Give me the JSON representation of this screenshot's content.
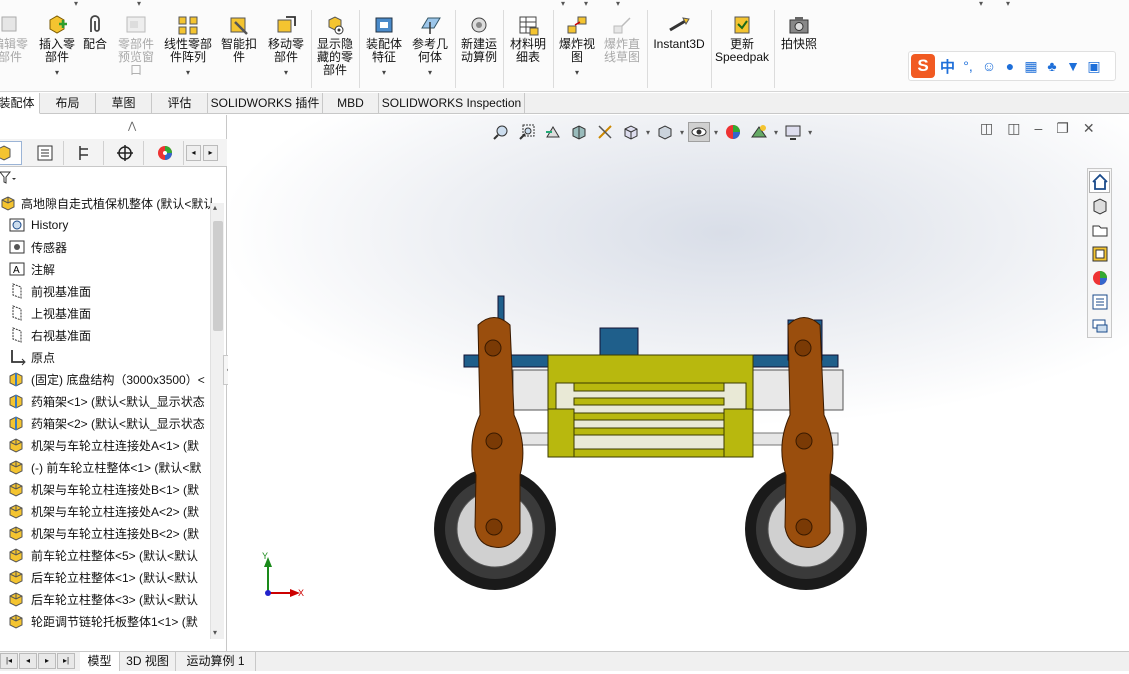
{
  "ribbon": {
    "buttons": [
      {
        "name": "edit-component-button",
        "label": "编辑零\n部件",
        "disabled": true,
        "dropdown": false
      },
      {
        "name": "insert-component-button",
        "label": "插入零\n部件",
        "disabled": false,
        "dropdown": true
      },
      {
        "name": "mate-button",
        "label": "配合",
        "disabled": false,
        "dropdown": false
      },
      {
        "name": "component-preview-window-button",
        "label": "零部件\n预览窗\n口",
        "disabled": true,
        "dropdown": false
      },
      {
        "name": "linear-component-pattern-button",
        "label": "线性零部\n件阵列",
        "disabled": false,
        "dropdown": true
      },
      {
        "name": "smart-fasteners-button",
        "label": "智能扣\n件",
        "disabled": false,
        "dropdown": false
      },
      {
        "name": "move-component-button",
        "label": "移动零\n部件",
        "disabled": false,
        "dropdown": true
      },
      {
        "name": "show-hidden-components-button",
        "label": "显示隐\n藏的零\n部件",
        "disabled": false,
        "dropdown": false
      },
      {
        "name": "assembly-features-button",
        "label": "装配体\n特征",
        "disabled": false,
        "dropdown": true
      },
      {
        "name": "reference-geometry-button",
        "label": "参考几\n何体",
        "disabled": false,
        "dropdown": true
      },
      {
        "name": "new-motion-study-button",
        "label": "新建运\n动算例",
        "disabled": false,
        "dropdown": false
      },
      {
        "name": "bill-of-materials-button",
        "label": "材料明\n细表",
        "disabled": false,
        "dropdown": false
      },
      {
        "name": "exploded-view-button",
        "label": "爆炸视\n图",
        "disabled": false,
        "dropdown": true
      },
      {
        "name": "explode-line-sketch-button",
        "label": "爆炸直\n线草图",
        "disabled": true,
        "dropdown": false
      },
      {
        "name": "instant3d-button",
        "label": "Instant3D",
        "disabled": false,
        "dropdown": false
      },
      {
        "name": "update-speedpak-button",
        "label": "更新\nSpeedpak",
        "disabled": false,
        "dropdown": false
      },
      {
        "name": "take-snapshot-button",
        "label": "拍快照",
        "disabled": false,
        "dropdown": false
      }
    ]
  },
  "ime": {
    "logo": "S",
    "lang": "中"
  },
  "tabs": [
    "装配体",
    "布局",
    "草图",
    "评估",
    "SOLIDWORKS 插件",
    "MBD",
    "SOLIDWORKS Inspection"
  ],
  "tree": {
    "root": "高地隙自走式植保机整体  (默认<默认_",
    "items": [
      {
        "label": "History",
        "icon": "history"
      },
      {
        "label": "传感器",
        "icon": "sensor"
      },
      {
        "label": "注解",
        "icon": "annotation"
      },
      {
        "label": "前视基准面",
        "icon": "plane"
      },
      {
        "label": "上视基准面",
        "icon": "plane"
      },
      {
        "label": "右视基准面",
        "icon": "plane"
      },
      {
        "label": "原点",
        "icon": "origin"
      },
      {
        "label": "(固定) 底盘结构（3000x3500）<",
        "icon": "part"
      },
      {
        "label": "药箱架<1> (默认<默认_显示状态",
        "icon": "part"
      },
      {
        "label": "药箱架<2> (默认<默认_显示状态",
        "icon": "part"
      },
      {
        "label": "机架与车轮立柱连接处A<1> (默",
        "icon": "asm"
      },
      {
        "label": "(-) 前车轮立柱整体<1> (默认<默",
        "icon": "asm"
      },
      {
        "label": "机架与车轮立柱连接处B<1> (默",
        "icon": "asm"
      },
      {
        "label": "机架与车轮立柱连接处A<2> (默",
        "icon": "asm"
      },
      {
        "label": "机架与车轮立柱连接处B<2> (默",
        "icon": "asm"
      },
      {
        "label": "前车轮立柱整体<5> (默认<默认",
        "icon": "asm"
      },
      {
        "label": "后车轮立柱整体<1> (默认<默认",
        "icon": "asm"
      },
      {
        "label": "后车轮立柱整体<3> (默认<默认",
        "icon": "asm"
      },
      {
        "label": "轮距调节链轮托板整体1<1> (默",
        "icon": "asm"
      }
    ]
  },
  "bottom_tabs": [
    "模型",
    "3D 视图",
    "运动算例 1"
  ],
  "triad": {
    "x": "X",
    "y": "Y"
  },
  "colors": {
    "frame": "#b8b80e",
    "column": "#9a4e0d",
    "blue": "#1f5f8b",
    "tire": "#1a1a1a",
    "rim": "#d0d0d0"
  }
}
